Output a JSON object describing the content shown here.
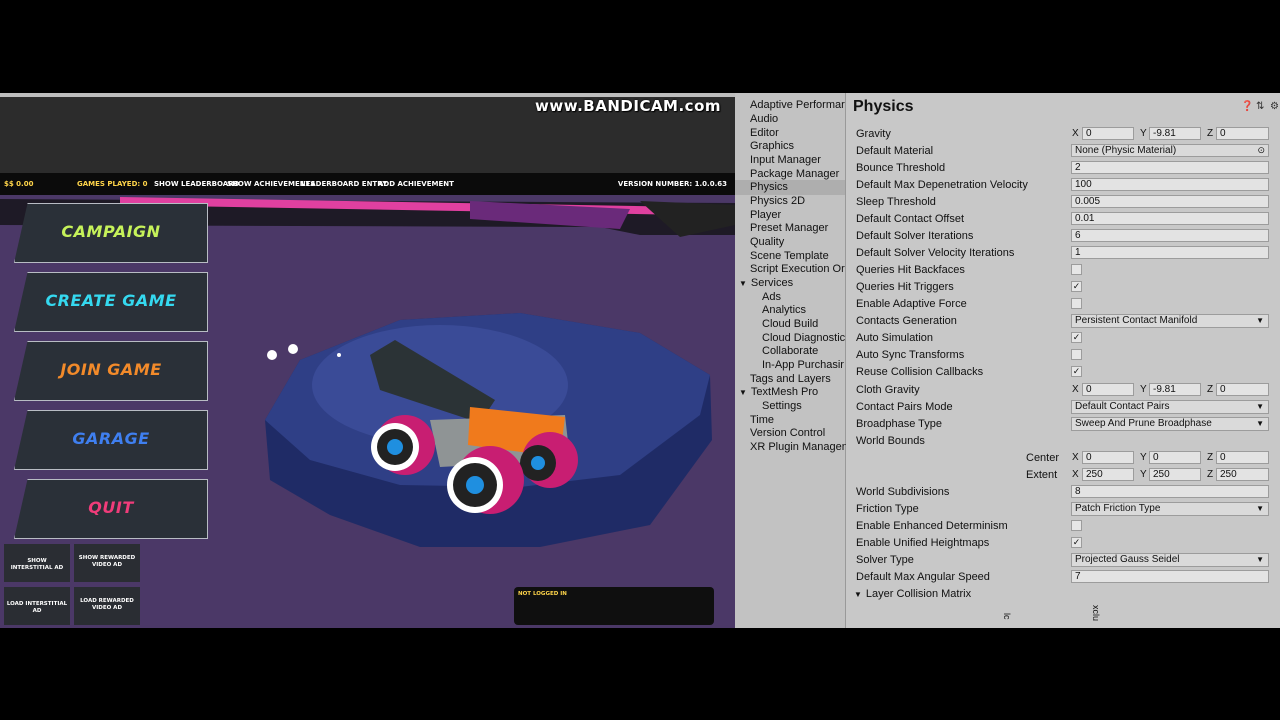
{
  "watermark": "www.BANDICAM.com",
  "game": {
    "hud": {
      "money": "$$ 0.00",
      "games_played": "GAMES PLAYED: 0",
      "buttons": [
        "SHOW LEADERBOARD",
        "SHOW ACHIEVEMENTS",
        "LEADERBOARD ENTRY",
        "ADD ACHIEVEMENT"
      ],
      "version": "VERSION NUMBER: 1.0.0.63"
    },
    "menu": {
      "campaign": "CAMPAIGN",
      "create_game": "CREATE GAME",
      "join_game": "JOIN GAME",
      "garage": "GARAGE",
      "quit": "QUIT"
    },
    "ads": {
      "show_interstitial": "SHOW INTERSTITIAL AD",
      "show_rewarded": "SHOW REWARDED VIDEO AD",
      "load_interstitial": "LOAD INTERSTITIAL AD",
      "load_rewarded": "LOAD REWARDED VIDEO AD"
    },
    "login_status": "NOT LOGGED IN"
  },
  "sidebar": {
    "items": [
      {
        "label": "Adaptive Performar"
      },
      {
        "label": "Audio"
      },
      {
        "label": "Editor"
      },
      {
        "label": "Graphics"
      },
      {
        "label": "Input Manager"
      },
      {
        "label": "Package Manager"
      },
      {
        "label": "Physics"
      },
      {
        "label": "Physics 2D"
      },
      {
        "label": "Player"
      },
      {
        "label": "Preset Manager"
      },
      {
        "label": "Quality"
      },
      {
        "label": "Scene Template"
      },
      {
        "label": "Script Execution Or"
      },
      {
        "label": "Services"
      },
      {
        "label": "Ads"
      },
      {
        "label": "Analytics"
      },
      {
        "label": "Cloud Build"
      },
      {
        "label": "Cloud Diagnostic"
      },
      {
        "label": "Collaborate"
      },
      {
        "label": "In-App Purchasir"
      },
      {
        "label": "Tags and Layers"
      },
      {
        "label": "TextMesh Pro"
      },
      {
        "label": "Settings"
      },
      {
        "label": "Time"
      },
      {
        "label": "Version Control"
      },
      {
        "label": "XR Plugin Managen"
      }
    ]
  },
  "physics": {
    "title": "Physics",
    "labels": {
      "gravity": "Gravity",
      "default_material": "Default Material",
      "bounce_threshold": "Bounce Threshold",
      "max_depenetration": "Default Max Depenetration Velocity",
      "sleep_threshold": "Sleep Threshold",
      "contact_offset": "Default Contact Offset",
      "solver_iterations": "Default Solver Iterations",
      "solver_velocity_iterations": "Default Solver Velocity Iterations",
      "queries_hit_backfaces": "Queries Hit Backfaces",
      "queries_hit_triggers": "Queries Hit Triggers",
      "adaptive_force": "Enable Adaptive Force",
      "contacts_generation": "Contacts Generation",
      "auto_simulation": "Auto Simulation",
      "auto_sync_transforms": "Auto Sync Transforms",
      "reuse_collision_callbacks": "Reuse Collision Callbacks",
      "cloth_gravity": "Cloth Gravity",
      "contact_pairs_mode": "Contact Pairs Mode",
      "broadphase_type": "Broadphase Type",
      "world_bounds": "World Bounds",
      "center": "Center",
      "extent": "Extent",
      "world_subdivisions": "World Subdivisions",
      "friction_type": "Friction Type",
      "enhanced_determinism": "Enable Enhanced Determinism",
      "unified_heightmaps": "Enable Unified Heightmaps",
      "solver_type": "Solver Type",
      "max_angular_speed": "Default Max Angular Speed",
      "layer_collision_matrix": "Layer Collision Matrix"
    },
    "axes": {
      "x": "X",
      "y": "Y",
      "z": "Z"
    },
    "values": {
      "gravity": {
        "x": "0",
        "y": "-9.81",
        "z": "0"
      },
      "default_material": "None (Physic Material)",
      "bounce_threshold": "2",
      "max_depenetration": "100",
      "sleep_threshold": "0.005",
      "contact_offset": "0.01",
      "solver_iterations": "6",
      "solver_velocity_iterations": "1",
      "queries_hit_backfaces": false,
      "queries_hit_triggers": true,
      "adaptive_force": false,
      "contacts_generation": "Persistent Contact Manifold",
      "auto_simulation": true,
      "auto_sync_transforms": false,
      "reuse_collision_callbacks": true,
      "cloth_gravity": {
        "x": "0",
        "y": "-9.81",
        "z": "0"
      },
      "contact_pairs_mode": "Default Contact Pairs",
      "broadphase_type": "Sweep And Prune Broadphase",
      "center": {
        "x": "0",
        "y": "0",
        "z": "0"
      },
      "extent": {
        "x": "250",
        "y": "250",
        "z": "250"
      },
      "world_subdivisions": "8",
      "friction_type": "Patch Friction Type",
      "enhanced_determinism": false,
      "unified_heightmaps": true,
      "solver_type": "Projected Gauss Seidel",
      "max_angular_speed": "7"
    },
    "matrix_column_labels": [
      "lc",
      "xclu"
    ]
  },
  "icons": {
    "help": "help-icon",
    "preset": "preset-icon",
    "settings": "gear-icon",
    "object_picker": "object-picker-icon"
  }
}
